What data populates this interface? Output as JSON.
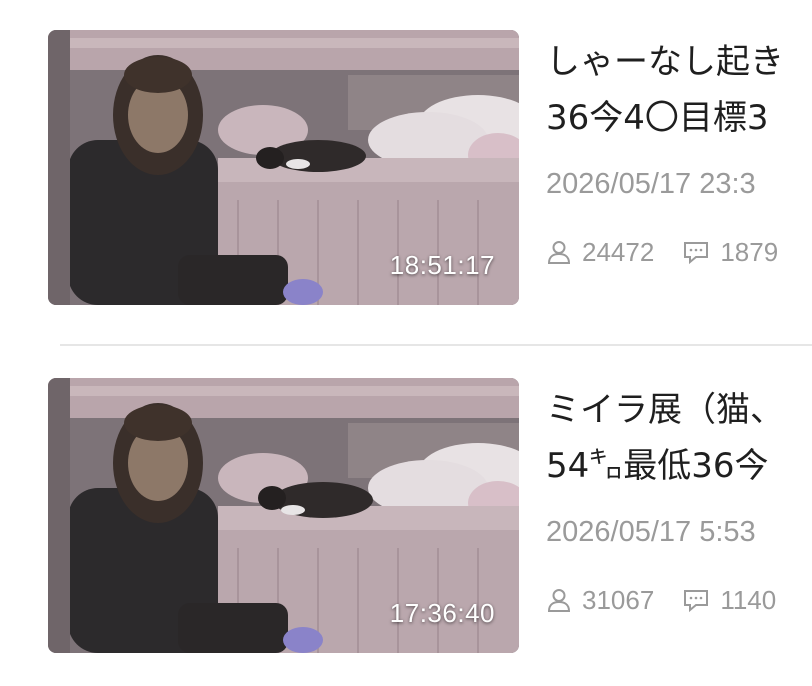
{
  "videos": [
    {
      "title": "しゃーなし起き\n36今4〇目標3",
      "duration": "18:51:17",
      "date": "2026/05/17 23:3",
      "views": "24472",
      "comments": "1879"
    },
    {
      "title": "ミイラ展（猫、\n54㌔最低36今",
      "duration": "17:36:40",
      "date": "2026/05/17 5:53",
      "views": "31067",
      "comments": "1140"
    }
  ],
  "icons": {
    "views": "user-icon",
    "comments": "comment-icon"
  },
  "colors": {
    "meta_text": "#9a9a9a",
    "title_text": "#1f1f1f",
    "duration_text": "#ffffff"
  }
}
